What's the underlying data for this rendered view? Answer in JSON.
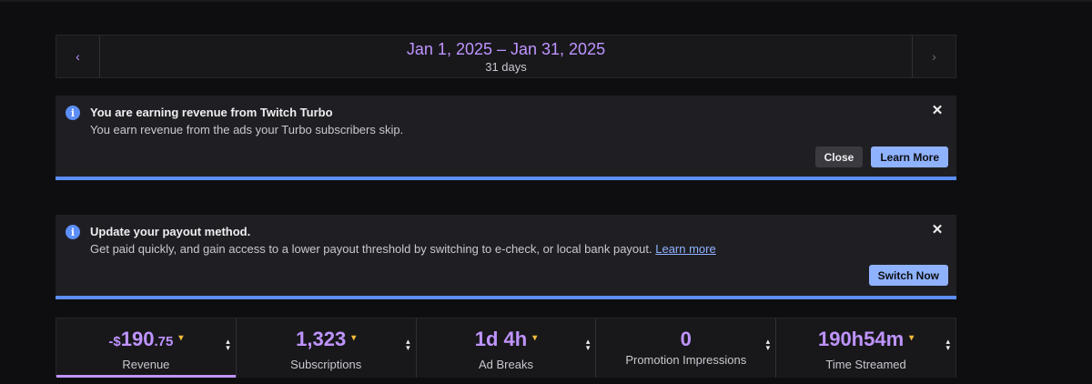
{
  "date_nav": {
    "range": "Jan 1, 2025 – Jan 31, 2025",
    "days": "31 days",
    "prev_icon": "chevron-left-icon",
    "next_icon": "chevron-right-icon"
  },
  "alerts": [
    {
      "title": "You are earning revenue from Twitch Turbo",
      "body": "You earn revenue from the ads your Turbo subscribers skip.",
      "buttons": {
        "close": "Close",
        "learn_more": "Learn More"
      }
    },
    {
      "title": "Update your payout method.",
      "body": "Get paid quickly, and gain access to a lower payout threshold by switching to e-check, or local bank payout.",
      "link": "Learn more",
      "buttons": {
        "switch_now": "Switch Now"
      }
    }
  ],
  "metrics": [
    {
      "value_prefix": "-$",
      "value": "190",
      "value_cents": ".75",
      "label": "Revenue",
      "trend": "down",
      "active": true
    },
    {
      "value": "1,323",
      "label": "Subscriptions",
      "trend": "down"
    },
    {
      "value": "1d 4h",
      "label": "Ad Breaks",
      "trend": "down"
    },
    {
      "value": "0",
      "label": "Promotion Impressions",
      "trend": "none"
    },
    {
      "value": "190h54m",
      "label": "Time Streamed",
      "trend": "down"
    }
  ],
  "colors": {
    "accent_purple": "#bf94ff",
    "info_blue": "#5c8ef8",
    "primary_button": "#8fb2ff",
    "trend_down": "#f3b93a",
    "background": "#0e0e10",
    "panel": "#18181b"
  }
}
